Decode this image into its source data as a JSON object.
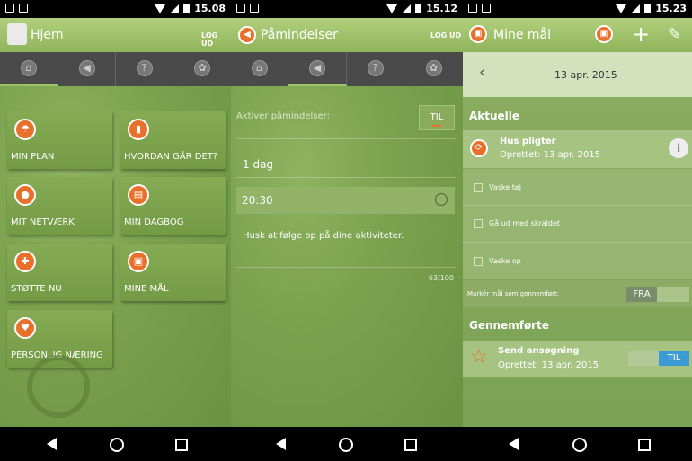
{
  "screen1": {
    "status": {
      "time": "15.08"
    },
    "title": "Hjem",
    "logout": "LOG UD",
    "tiles": [
      {
        "label": "MIN PLAN",
        "icon": "umbrella-icon"
      },
      {
        "label": "HVORDAN GÅR DET?",
        "icon": "chart-icon"
      },
      {
        "label": "MIT NETVÆRK",
        "icon": "speech-icon"
      },
      {
        "label": "MIN DAGBOG",
        "icon": "diary-icon"
      },
      {
        "label": "STØTTE NU",
        "icon": "lifebuoy-icon"
      },
      {
        "label": "MINE MÅL",
        "icon": "clipboard-icon"
      },
      {
        "label": "PERSONLIG NÆRING",
        "icon": "heart-icon"
      }
    ]
  },
  "screen2": {
    "status": {
      "time": "15.12"
    },
    "title": "Påmindelser",
    "logout": "LOG UD",
    "activate_label": "Aktiver påmindelser:",
    "activate_toggle": "TIL",
    "frequency": "1 dag",
    "time_value": "20:30",
    "message": "Husk at følge op på dine aktiviteter.",
    "char_count": "63/100"
  },
  "screen3": {
    "status": {
      "time": "15.23"
    },
    "title": "Mine mål",
    "date": "13 apr. 2015",
    "section_current": "Aktuelle",
    "goal_title": "Hus pligter",
    "goal_created": "Oprettet: 13 apr. 2015",
    "tasks": [
      "Vaske tøj",
      "Gå ud med skraldet",
      "Vaske op"
    ],
    "mark_label": "Markér mål som gennemført:",
    "mark_toggle": "FRA",
    "section_done": "Gennemførte",
    "done_title": "Send ansøgning",
    "done_created": "Oprettet: 13 apr. 2015",
    "done_toggle": "TIL"
  },
  "colors": {
    "accent_orange": "#e8702a",
    "green": "#7aa24f",
    "toggle_blue": "#3a9bd5"
  }
}
